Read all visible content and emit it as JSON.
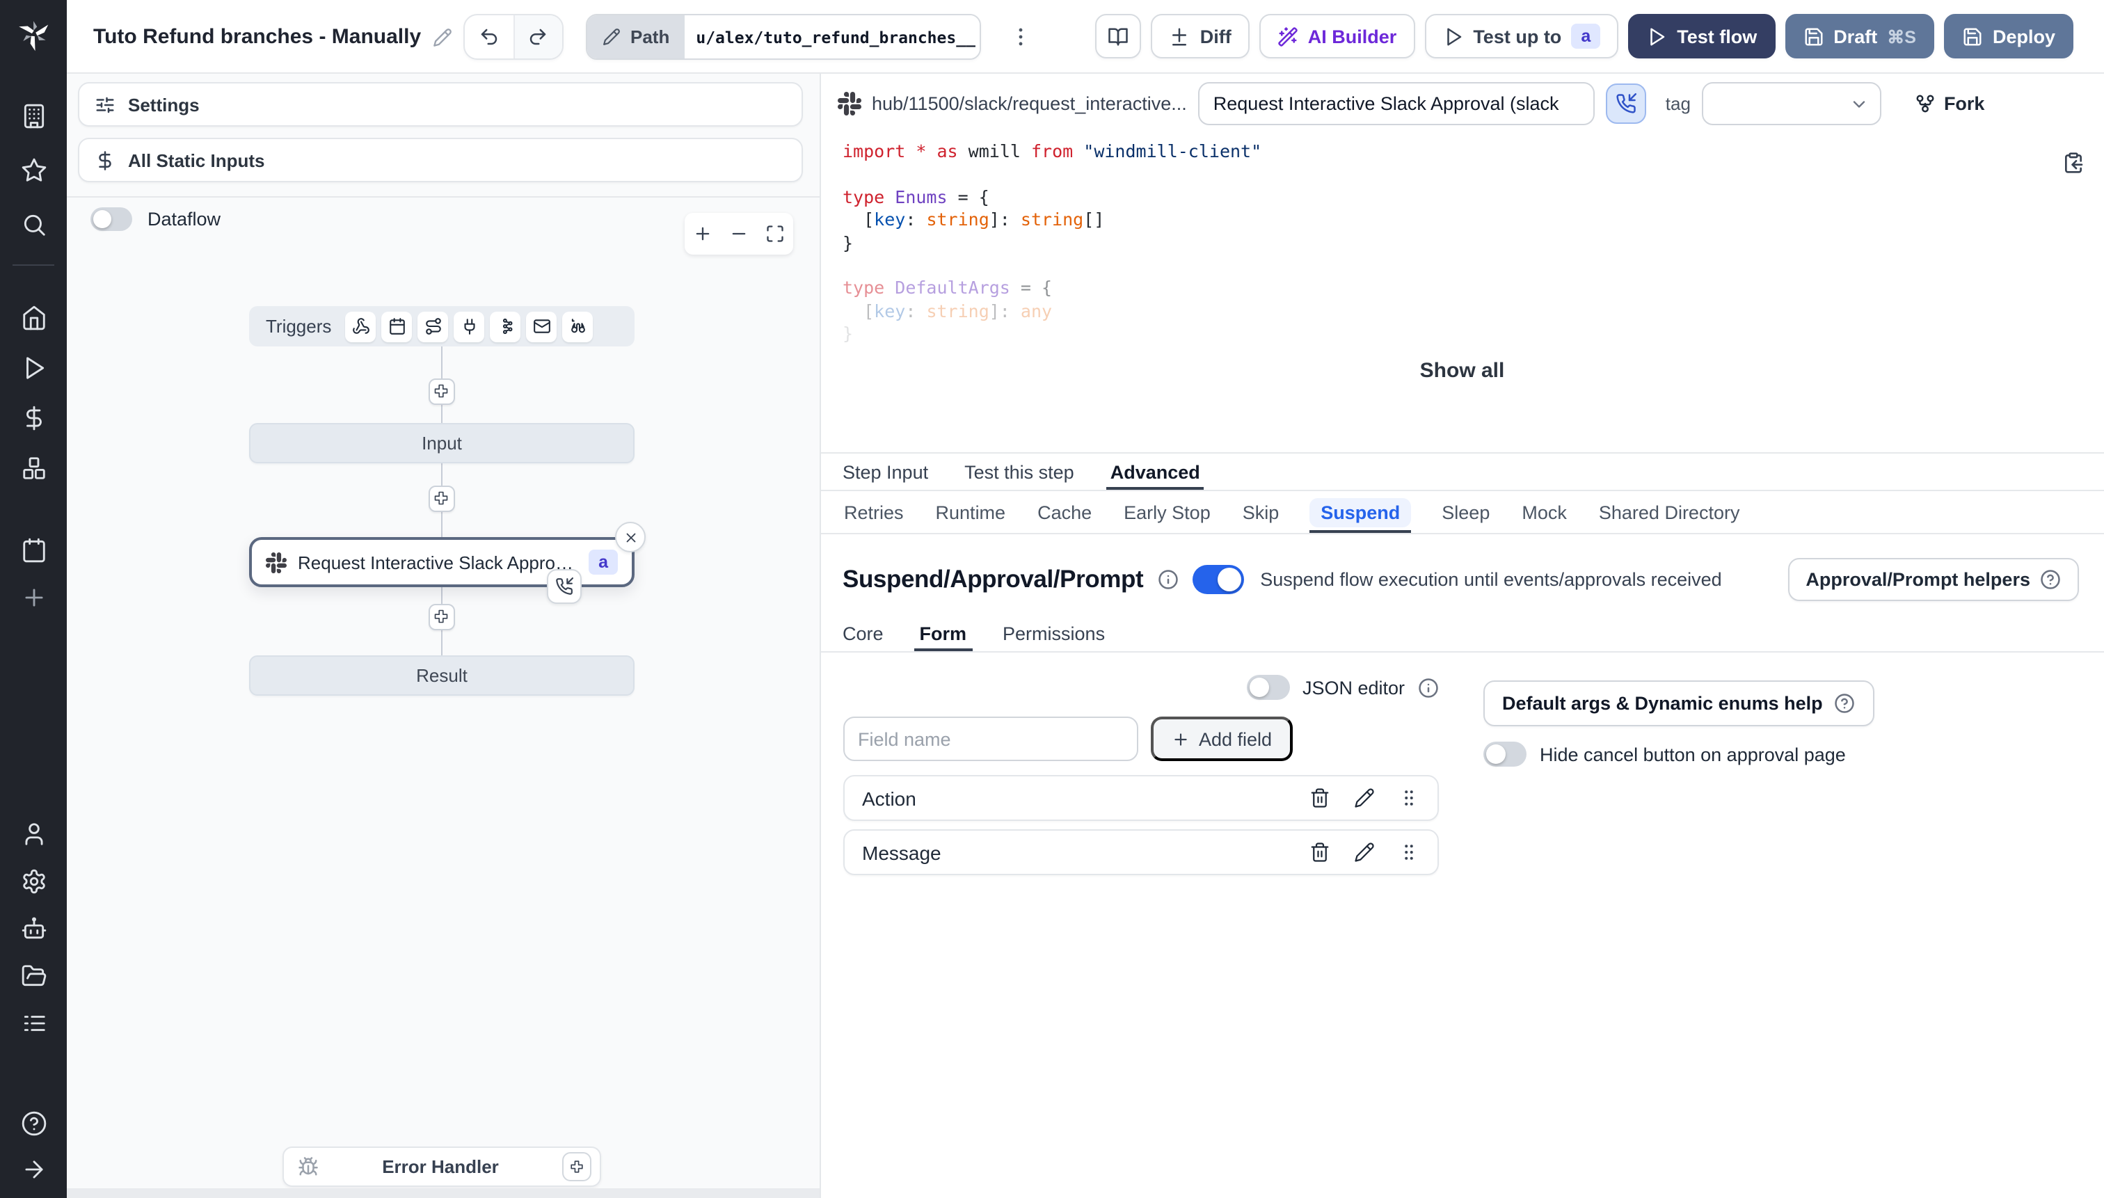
{
  "colors": {
    "accent": "#2563eb",
    "badge_bg": "#e0e7ff",
    "badge_text": "#4338ca",
    "test_flow_bg": "#343e63",
    "deploy_bg": "#5f7699",
    "ai_text": "#6d28d9",
    "node_border": "#5b6880",
    "rail_bg": "#21242b"
  },
  "topbar": {
    "title": "Tuto Refund branches - Manually",
    "path_label": "Path",
    "path_value": "u/alex/tuto_refund_branches__",
    "diff_label": "Diff",
    "ai_builder_label": "AI Builder",
    "test_up_to_label": "Test up to",
    "test_up_to_badge": "a",
    "test_flow_label": "Test flow",
    "draft_label": "Draft",
    "draft_shortcut": "⌘S",
    "deploy_label": "Deploy"
  },
  "rail": {
    "top_icons": [
      "building-icon",
      "star-icon",
      "search-icon"
    ],
    "main_icons": [
      "home-icon",
      "play-icon",
      "dollar-icon",
      "resources-icon"
    ],
    "secondary_icons": [
      "calendar-icon",
      "plus-icon"
    ],
    "bottom_icons": [
      "user-icon",
      "gear-icon",
      "robot-icon",
      "folder-icon",
      "list-icon"
    ],
    "footer_icons": [
      "help-icon",
      "arrow-right-icon"
    ]
  },
  "left_panel": {
    "settings_label": "Settings",
    "static_inputs_label": "All Static Inputs",
    "dataflow_label": "Dataflow"
  },
  "graph": {
    "triggers_label": "Triggers",
    "trigger_icons": [
      "webhook-icon",
      "schedule-icon",
      "route-icon",
      "websocket-icon",
      "kafka-icon",
      "email-icon",
      "poll-icon"
    ],
    "input_label": "Input",
    "step_label": "Request Interactive Slack Approval (...",
    "step_badge": "a",
    "result_label": "Result",
    "error_handler_label": "Error Handler"
  },
  "inspector": {
    "hub_path": "hub/11500/slack/request_interactive...",
    "summary_value": "Request Interactive Slack Approval (slack",
    "tag_label": "tag",
    "fork_label": "Fork",
    "show_all_label": "Show all",
    "tabs": [
      "Step Input",
      "Test this step",
      "Advanced"
    ],
    "active_tab": "Advanced",
    "subtabs": [
      "Retries",
      "Runtime",
      "Cache",
      "Early Stop",
      "Skip",
      "Suspend",
      "Sleep",
      "Mock",
      "Shared Directory"
    ],
    "active_subtab": "Suspend",
    "code": {
      "lines": [
        {
          "tokens": [
            {
              "c": "k",
              "t": "import"
            },
            {
              "c": "p",
              "t": " "
            },
            {
              "c": "k",
              "t": "*"
            },
            {
              "c": "p",
              "t": " "
            },
            {
              "c": "k",
              "t": "as"
            },
            {
              "c": "p",
              "t": " wmill "
            },
            {
              "c": "k",
              "t": "from"
            },
            {
              "c": "p",
              "t": " "
            },
            {
              "c": "s",
              "t": "\"windmill-client\""
            }
          ]
        },
        {
          "tokens": []
        },
        {
          "tokens": [
            {
              "c": "k",
              "t": "type"
            },
            {
              "c": "p",
              "t": " "
            },
            {
              "c": "t",
              "t": "Enums"
            },
            {
              "c": "p",
              "t": " = {"
            }
          ]
        },
        {
          "tokens": [
            {
              "c": "p",
              "t": "  ["
            },
            {
              "c": "v",
              "t": "key"
            },
            {
              "c": "p",
              "t": ": "
            },
            {
              "c": "o",
              "t": "string"
            },
            {
              "c": "p",
              "t": "]: "
            },
            {
              "c": "o",
              "t": "string"
            },
            {
              "c": "p",
              "t": "[]"
            }
          ]
        },
        {
          "tokens": [
            {
              "c": "p",
              "t": "}"
            }
          ]
        },
        {
          "tokens": []
        },
        {
          "tokens": [
            {
              "c": "k",
              "t": "type"
            },
            {
              "c": "p",
              "t": " "
            },
            {
              "c": "t",
              "t": "DefaultArgs"
            },
            {
              "c": "p",
              "t": " = {"
            }
          ],
          "fade": 0.5
        },
        {
          "tokens": [
            {
              "c": "p",
              "t": "  ["
            },
            {
              "c": "v",
              "t": "key"
            },
            {
              "c": "p",
              "t": ": "
            },
            {
              "c": "o",
              "t": "string"
            },
            {
              "c": "p",
              "t": "]: "
            },
            {
              "c": "o",
              "t": "any"
            }
          ],
          "fade": 0.3
        },
        {
          "tokens": [
            {
              "c": "p",
              "t": "}"
            }
          ],
          "fade": 0.13
        }
      ]
    },
    "suspend": {
      "heading": "Suspend/Approval/Prompt",
      "toggle_on": true,
      "toggle_text": "Suspend flow execution until events/approvals received",
      "helpers_label": "Approval/Prompt helpers",
      "tabs": [
        "Core",
        "Form",
        "Permissions"
      ],
      "active_tab": "Form",
      "json_editor_label": "JSON editor",
      "field_placeholder": "Field name",
      "add_field_label": "Add field",
      "default_args_help_label": "Default args & Dynamic enums help",
      "hide_cancel_label": "Hide cancel button on approval page",
      "fields": [
        "Action",
        "Message"
      ]
    }
  }
}
